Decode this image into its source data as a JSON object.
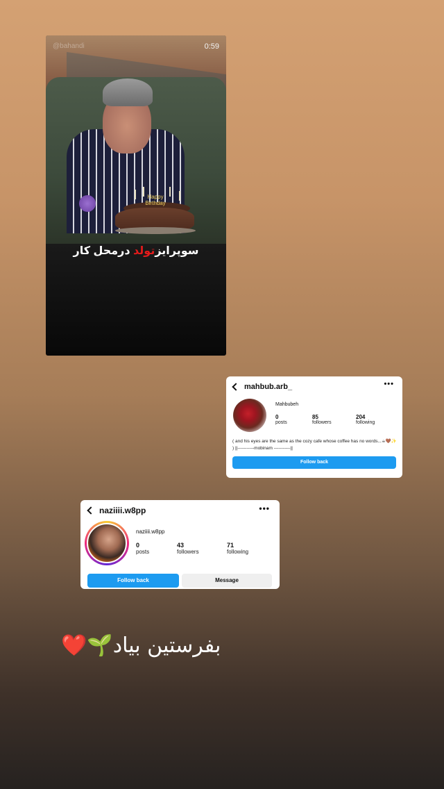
{
  "video": {
    "watermark": "@bahandi",
    "time": "0:59",
    "cake_sign": "Happy Birthday",
    "caption_part1": "سوپرایز",
    "caption_red": "تولد",
    "caption_part2": "درمحل کار"
  },
  "card1": {
    "username": "mahbub.arb_",
    "display_name": "Mahbubeh",
    "stats": [
      {
        "value": "0",
        "label": "posts"
      },
      {
        "value": "85",
        "label": "followers"
      },
      {
        "value": "204",
        "label": "following"
      }
    ],
    "bio": "( and his eyes are the same as the cozy cafe whose coffee has no words...☕🤎✨ ) ||-----------mobinam -----------||",
    "follow_back": "Follow back"
  },
  "card2": {
    "username": "naziiii.w8pp",
    "display_name": "naziiii.w8pp",
    "stats": [
      {
        "value": "0",
        "label": "posts"
      },
      {
        "value": "43",
        "label": "followers"
      },
      {
        "value": "71",
        "label": "following"
      }
    ],
    "follow_back": "Follow back",
    "message": "Message"
  },
  "bottom_caption": "بفرستین بیاد🌱❤️"
}
